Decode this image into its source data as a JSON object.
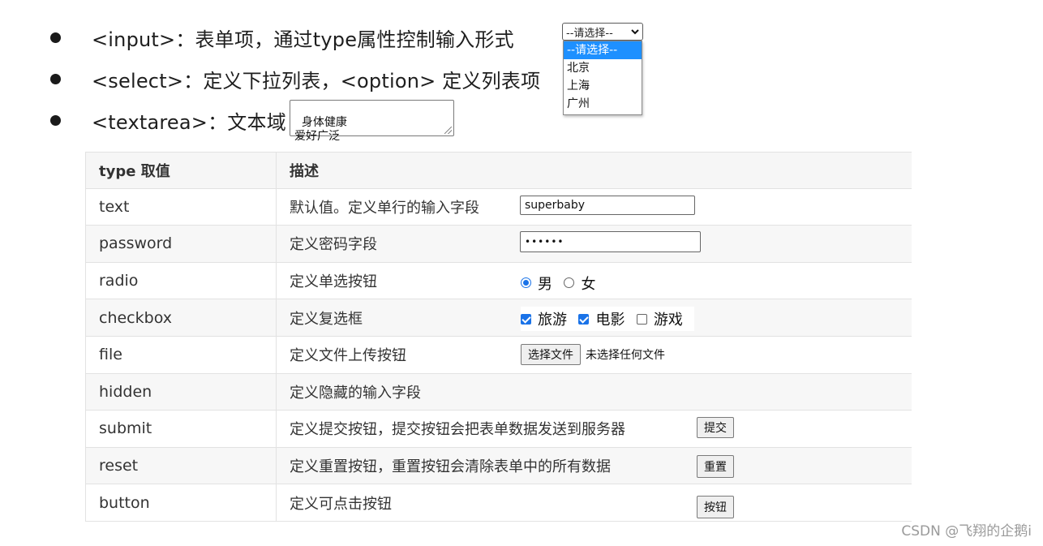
{
  "bullets": [
    {
      "text": "<input>：表单项，通过type属性控制输入形式"
    },
    {
      "text": "<select>：定义下拉列表，<option> 定义列表项"
    },
    {
      "text": "<textarea>：文本域"
    }
  ],
  "select_demo": {
    "selected": "--请选择--",
    "options": [
      "--请选择--",
      "北京",
      "上海",
      "广州"
    ]
  },
  "textarea_demo": {
    "value": "身体健康\n爱好广泛"
  },
  "table": {
    "headers": {
      "type": "type 取值",
      "desc": "描述"
    },
    "rows": [
      {
        "type": "text",
        "desc": "默认值。定义单行的输入字段"
      },
      {
        "type": "password",
        "desc": "定义密码字段"
      },
      {
        "type": "radio",
        "desc": "定义单选按钮"
      },
      {
        "type": "checkbox",
        "desc": "定义复选框"
      },
      {
        "type": "file",
        "desc": "定义文件上传按钮"
      },
      {
        "type": "hidden",
        "desc": "定义隐藏的输入字段"
      },
      {
        "type": "submit",
        "desc": "定义提交按钮，提交按钮会把表单数据发送到服务器"
      },
      {
        "type": "reset",
        "desc": "定义重置按钮，重置按钮会清除表单中的所有数据"
      },
      {
        "type": "button",
        "desc": "定义可点击按钮"
      }
    ]
  },
  "demos": {
    "text_value": "superbaby",
    "password_value": "••••••",
    "radio": [
      {
        "label": "男",
        "checked": true
      },
      {
        "label": "女",
        "checked": false
      }
    ],
    "checkbox": [
      {
        "label": "旅游",
        "checked": true
      },
      {
        "label": "电影",
        "checked": true
      },
      {
        "label": "游戏",
        "checked": false
      }
    ],
    "file_button": "选择文件",
    "file_status": "未选择任何文件",
    "submit_label": "提交",
    "reset_label": "重置",
    "button_label": "按钮"
  },
  "watermark": "CSDN @飞翔的企鹅i",
  "colors": {
    "accent": "#1e90ff",
    "check": "#1a73e8"
  }
}
